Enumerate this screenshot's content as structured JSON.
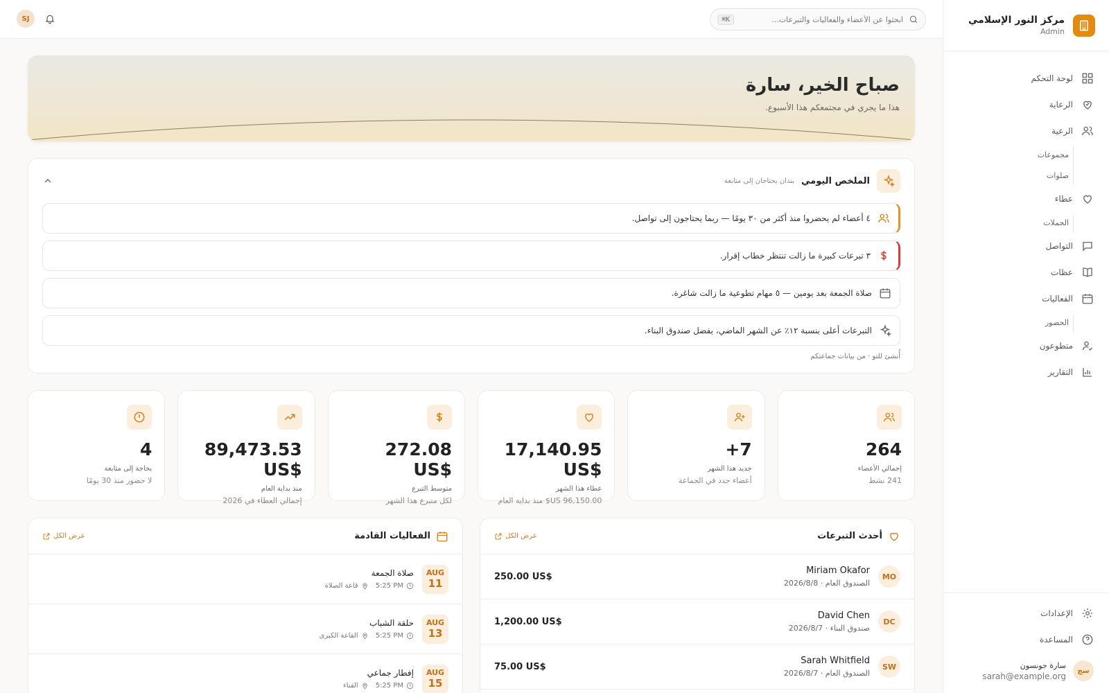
{
  "sidebar": {
    "org_name": "مركز النور الإسلامي",
    "role": "Admin",
    "items": [
      {
        "label": "لوحة التحكم",
        "icon": "dashboard-icon"
      },
      {
        "label": "الرعاية",
        "icon": "care-icon"
      },
      {
        "label": "الرعية",
        "icon": "people-icon"
      },
      {
        "label": "مجموعات",
        "sub": true
      },
      {
        "label": "صلوات",
        "sub": true
      },
      {
        "label": "عطاء",
        "icon": "heart-icon"
      },
      {
        "label": "الحملات",
        "sub": true
      },
      {
        "label": "التواصل",
        "icon": "message-icon"
      },
      {
        "label": "عظات",
        "icon": "book-icon"
      },
      {
        "label": "الفعاليات",
        "icon": "calendar-icon"
      },
      {
        "label": "الحضور",
        "sub": true
      },
      {
        "label": "متطوعون",
        "icon": "volunteer-icon"
      },
      {
        "label": "التقارير",
        "icon": "reports-icon"
      }
    ],
    "settings_label": "الإعدادات",
    "help_label": "المساعدة",
    "user": {
      "initials": "سج",
      "name": "سارة جونسون",
      "email": "sarah@example.org"
    }
  },
  "topbar": {
    "search_placeholder": "ابحثوا عن الأعضاء والفعاليات والتبرعات...",
    "shortcut": "⌘K",
    "user_initials": "SJ"
  },
  "hero": {
    "title": "صباح الخير، سارة",
    "subtitle": "هذا ما يجري في مجتمعكم هذا الأسبوع."
  },
  "summary": {
    "title": "الملخص اليومي",
    "note": "بندان يحتاجان إلى متابعة",
    "alerts": [
      {
        "text": "٤ أعضاء لم يحضروا منذ أكثر من ٣٠ يومًا — ربما يحتاجون إلى تواصل.",
        "tone": "orange",
        "icon": "people-icon"
      },
      {
        "text": "٣ تبرعات كبيرة ما زالت تنتظر خطاب إقرار.",
        "tone": "red",
        "icon": "dollar-icon"
      },
      {
        "text": "صلاة الجمعة بعد يومين — ٥ مهام تطوعية ما زالت شاغرة.",
        "tone": "none",
        "icon": "calendar-icon"
      },
      {
        "text": "التبرعات أعلى بنسبة ١٢٪ عن الشهر الماضي، بفضل صندوق البناء.",
        "tone": "none",
        "icon": "sparkle-icon"
      }
    ],
    "footer": "أُنشئ للتو · من بيانات جماعتكم"
  },
  "stats": [
    {
      "icon": "people-icon",
      "value": "264",
      "label": "إجمالي الأعضاء",
      "sub": "241 نشط"
    },
    {
      "icon": "user-plus-icon",
      "value": "+7",
      "label": "جديد هذا الشهر",
      "sub": "أعضاء جدد في الجماعة"
    },
    {
      "icon": "heart-icon",
      "value": "17,140.95 US$",
      "label": "عطاء هذا الشهر",
      "sub": "96,150.00 US$ منذ بداية العام"
    },
    {
      "icon": "dollar-icon",
      "value": "272.08 US$",
      "label": "متوسط التبرع",
      "sub": "لكل متبرع هذا الشهر"
    },
    {
      "icon": "trending-icon",
      "value": "89,473.53 US$",
      "label": "منذ بداية العام",
      "sub": "إجمالي العطاء في 2026"
    },
    {
      "icon": "alert-icon",
      "value": "4",
      "label": "بحاجة إلى متابعة",
      "sub": "لا حضور منذ 30 يومًا"
    }
  ],
  "donations": {
    "title": "أحدث التبرعات",
    "view_all": "عرض الكل",
    "rows": [
      {
        "initials": "MO",
        "name": "Miriam Okafor",
        "meta": "الصندوق العام · 2026/8/8",
        "amount": "250.00 US$"
      },
      {
        "initials": "DC",
        "name": "David Chen",
        "meta": "صندوق البناء · 2026/8/7",
        "amount": "1,200.00 US$"
      },
      {
        "initials": "SW",
        "name": "Sarah Whitfield",
        "meta": "الصندوق العام · 2026/8/7",
        "amount": "75.00 US$"
      }
    ]
  },
  "events": {
    "title": "الفعاليات القادمة",
    "view_all": "عرض الكل",
    "rows": [
      {
        "month": "AUG",
        "day": "11",
        "title": "صلاة الجمعة",
        "time": "5:25 PM",
        "place": "قاعة الصلاة"
      },
      {
        "month": "AUG",
        "day": "13",
        "title": "حلقة الشباب",
        "time": "5:25 PM",
        "place": "القاعة الكبرى"
      },
      {
        "month": "AUG",
        "day": "15",
        "title": "إفطار جماعي",
        "time": "5:25 PM",
        "place": "الفناء"
      }
    ]
  },
  "colors": {
    "accent": "#e28a12",
    "accent_soft": "#fbeedc",
    "alert_orange": "#e19328",
    "alert_red": "#d63c3c"
  }
}
